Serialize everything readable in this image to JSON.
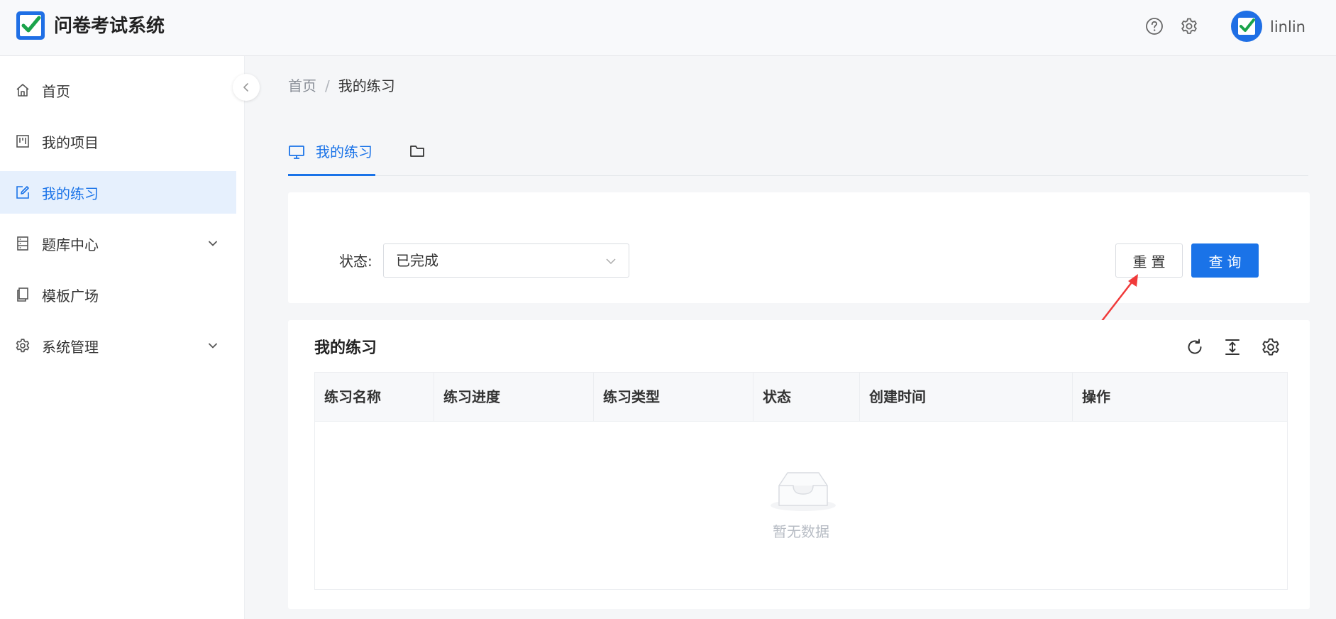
{
  "header": {
    "title": "问卷考试系统",
    "username": "linlin",
    "icons": [
      "help-icon",
      "gear-icon"
    ]
  },
  "sidebar": {
    "items": [
      {
        "label": "首页",
        "icon": "home-icon",
        "expandable": false,
        "active": false
      },
      {
        "label": "我的项目",
        "icon": "project-icon",
        "expandable": false,
        "active": false
      },
      {
        "label": "我的练习",
        "icon": "edit-icon",
        "expandable": false,
        "active": true
      },
      {
        "label": "题库中心",
        "icon": "database-icon",
        "expandable": true,
        "active": false
      },
      {
        "label": "模板广场",
        "icon": "template-icon",
        "expandable": false,
        "active": false
      },
      {
        "label": "系统管理",
        "icon": "gear-icon",
        "expandable": true,
        "active": false
      }
    ]
  },
  "breadcrumb": {
    "home": "首页",
    "separator": "/",
    "current": "我的练习"
  },
  "tabs": [
    {
      "label": "我的练习",
      "icon": "monitor-icon",
      "active": true
    },
    {
      "label": "",
      "icon": "folder-icon",
      "active": false
    }
  ],
  "filter": {
    "status_label": "状态:",
    "status_value": "已完成",
    "reset_label": "重置",
    "query_label": "查询"
  },
  "table": {
    "title": "我的练习",
    "columns": [
      "练习名称",
      "练习进度",
      "练习类型",
      "状态",
      "创建时间",
      "操作"
    ],
    "rows": [],
    "empty_text": "暂无数据",
    "tools": [
      "refresh-icon",
      "column-height-icon",
      "settings-icon"
    ]
  },
  "colors": {
    "primary": "#1a73e8",
    "active_bg": "#e6f0fd",
    "annotation": "#f03a3a"
  }
}
